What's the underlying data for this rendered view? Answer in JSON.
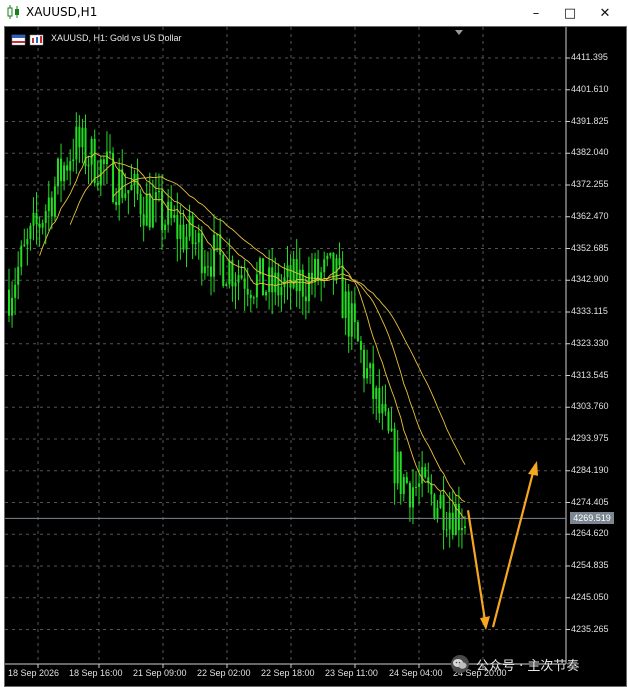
{
  "window": {
    "title": "XAUUSD,H1",
    "minimize_glyph": "–",
    "maximize_glyph": "□",
    "close_glyph": "✕"
  },
  "chart": {
    "symbol_label": "XAUUSD, H1:  Gold vs US Dollar",
    "current_price_label": "4269.519",
    "price_labels": [
      "4411.395",
      "4401.610",
      "4391.825",
      "4382.040",
      "4372.255",
      "4362.470",
      "4352.685",
      "4342.900",
      "4333.115",
      "4323.330",
      "4313.545",
      "4303.760",
      "4293.975",
      "4284.190",
      "4274.405",
      "4264.620",
      "4254.835",
      "4245.050",
      "4235.265"
    ],
    "date_labels": [
      "18 Sep 2026",
      "18 Sep 16:00",
      "21 Sep 09:00",
      "22 Sep 02:00",
      "22 Sep 18:00",
      "23 Sep 11:00",
      "24 Sep 04:00",
      "24 Sep 20:00"
    ],
    "colors": {
      "background": "#000000",
      "grid": "#9a9a9a",
      "candle": "#22dd22",
      "ma": "#e8c23a",
      "arrow": "#f5a623",
      "price_line": "#7d8791"
    },
    "icons": {
      "app": "candlestick-icon",
      "symbol": "flag-icon"
    }
  },
  "chart_data": {
    "type": "line",
    "title": "XAUUSD, H1:  Gold vs US Dollar",
    "xlabel": "",
    "ylabel": "",
    "x": [
      "18 Sep 2026",
      "18 Sep 16:00",
      "21 Sep 09:00",
      "22 Sep 02:00",
      "22 Sep 18:00",
      "23 Sep 11:00",
      "24 Sep 04:00",
      "24 Sep 20:00"
    ],
    "ylim": [
      4230,
      4417
    ],
    "grid": true,
    "series": [
      {
        "values": [
          4340,
          4385,
          4368,
          4352,
          4340,
          4345,
          4282,
          4270
        ]
      }
    ],
    "last_price": 4269.519,
    "annotations": [
      "arrow down to ~4235",
      "arrow up to ~4287"
    ]
  },
  "watermark": {
    "text": "公众号 · 主次节奏"
  }
}
